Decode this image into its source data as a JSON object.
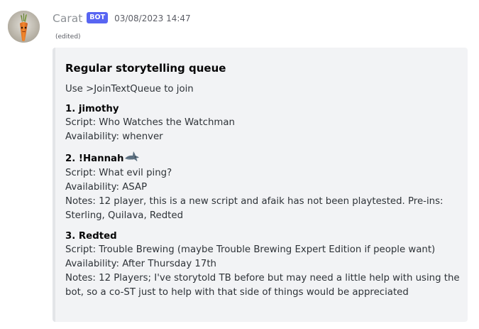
{
  "message": {
    "username": "Carat",
    "bot_tag": "BOT",
    "timestamp": "03/08/2023 14:47",
    "edited": "(edited)"
  },
  "embed": {
    "title": "Regular storytelling queue",
    "description": "Use >JoinTextQueue to join",
    "fields": [
      {
        "name": "1. jimothy",
        "lines": [
          "Script: Who Watches the Watchman",
          "Availability: whenver"
        ]
      },
      {
        "name": "2. !Hannah",
        "name_emoji": "shark-emoji",
        "lines": [
          "Script: What evil ping?",
          "Availability: ASAP",
          "Notes: 12 player, this is a new script and afaik has not been playtested. Pre-ins:",
          "Sterling, Quilava, Redted"
        ]
      },
      {
        "name": "3. Redted",
        "lines": [
          "Script: Trouble Brewing (maybe Trouble Brewing Expert Edition if people want)",
          "Availability: After Thursday 17th",
          "Notes: 12 Players; I've storytold TB before but may need a little help with using the",
          "bot, so a co-ST just to help with that side of things would be appreciated"
        ]
      }
    ]
  },
  "colors": {
    "bot_tag": "#5865f2",
    "embed_bg": "#f2f3f5",
    "embed_border": "#e3e5e8",
    "username": "#8e9297"
  }
}
